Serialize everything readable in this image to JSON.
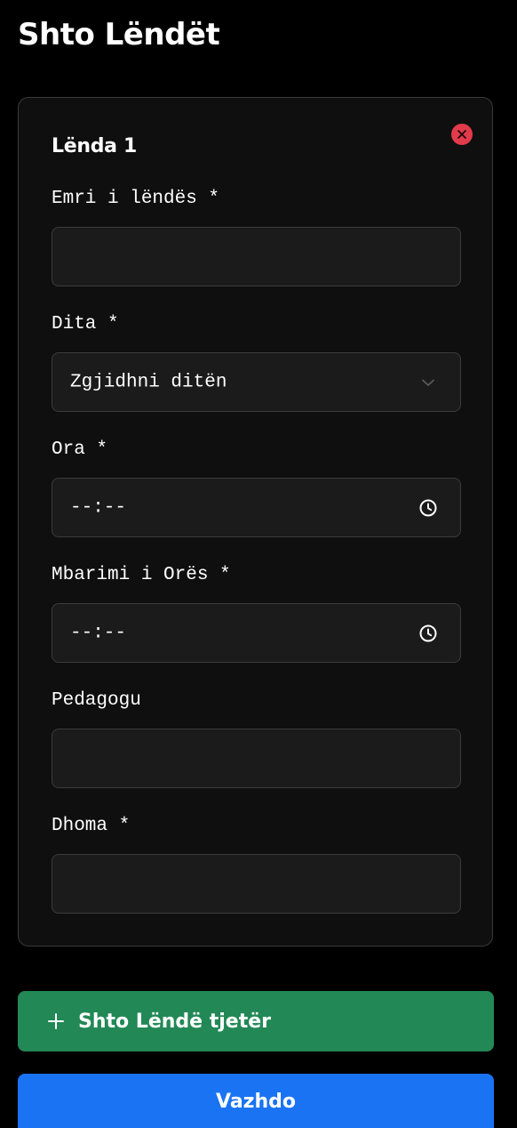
{
  "page": {
    "title": "Shto Lëndët"
  },
  "subject_card": {
    "title": "Lënda 1",
    "remove_icon": "close-icon",
    "fields": {
      "name": {
        "label": "Emri i lëndës *",
        "value": ""
      },
      "day": {
        "label": "Dita *",
        "value": "Zgjidhni ditën",
        "icon": "chevron-down-icon"
      },
      "start_time": {
        "label": "Ora *",
        "value": "--:--",
        "icon": "clock-icon"
      },
      "end_time": {
        "label": "Mbarimi i Orës *",
        "value": "--:--",
        "icon": "clock-icon"
      },
      "teacher": {
        "label": "Pedagogu",
        "value": ""
      },
      "room": {
        "label": "Dhoma *",
        "value": ""
      }
    }
  },
  "actions": {
    "add_subject_label": "Shto Lëndë tjetër",
    "add_icon": "plus-icon",
    "continue_label": "Vazhdo"
  },
  "colors": {
    "background": "#000000",
    "card": "#0f0f0f",
    "input": "#1b1b1b",
    "remove": "#e23b4b",
    "add_button": "#228856",
    "continue_button": "#1a73f2"
  }
}
